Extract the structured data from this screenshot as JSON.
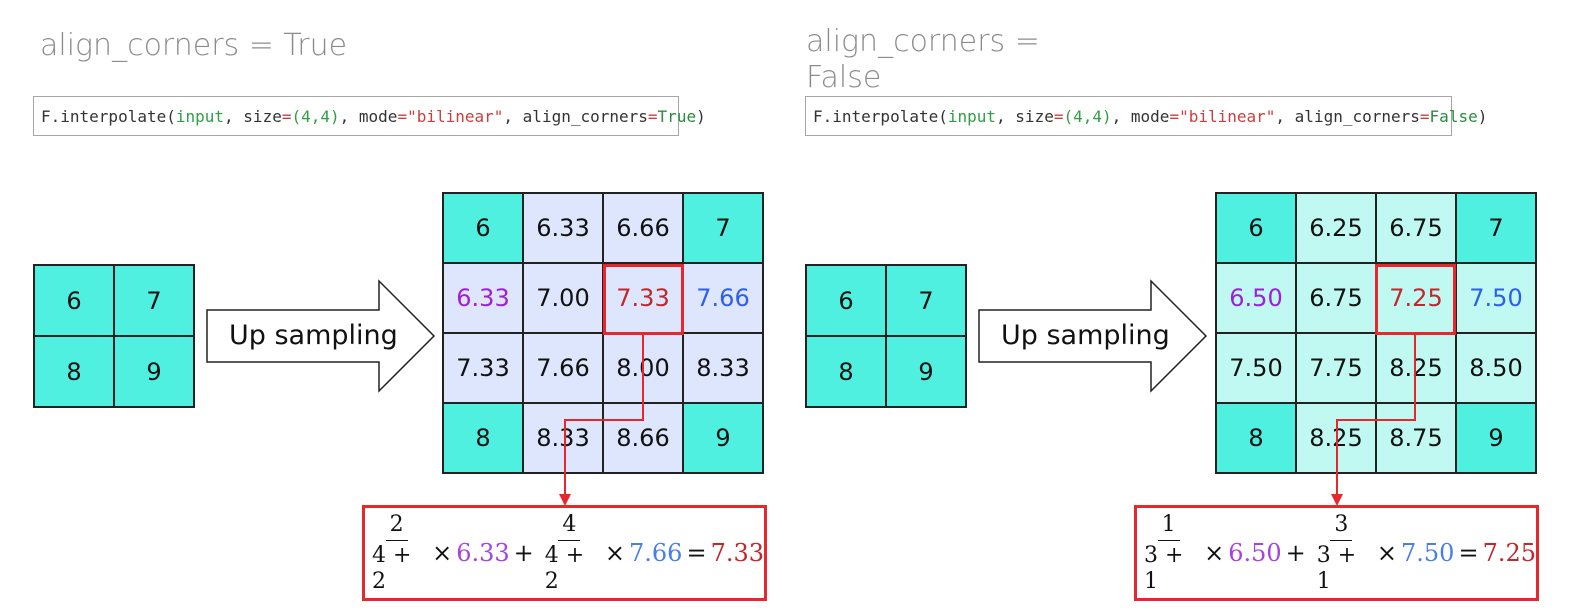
{
  "colors": {
    "corner_cell": "#4ff0e0",
    "left_interp_cell": "#dde6fd",
    "right_interp_cell": "#bff9f1",
    "small_grid_cell": "#4ff0e0",
    "highlight": "#e8262b",
    "purple": "#a020d8",
    "blue": "#2e5fe6",
    "dark_red": "#c1272d",
    "formula_purple": "#a445e0",
    "formula_blue": "#4a7ee8",
    "formula_red": "#c1272d"
  },
  "panels": [
    {
      "title": "align_corners = True",
      "code": {
        "fn": "F.interpolate(",
        "arg_input": "input",
        "sep1": ", size",
        "eq1": "=",
        "size_val": "(4,4)",
        "sep2": ", mode",
        "eq2": "=",
        "mode_val": "\"bilinear\"",
        "sep3": ", align_corners",
        "eq3": "=",
        "bool_val": "True",
        "close": ")"
      },
      "input_grid": [
        "6",
        "7",
        "8",
        "9"
      ],
      "arrow_label": "Up sampling",
      "output_grid": [
        [
          "6",
          "6.33",
          "6.66",
          "7"
        ],
        [
          "6.33",
          "7.00",
          "7.33",
          "7.66"
        ],
        [
          "7.33",
          "7.66",
          "8.00",
          "8.33"
        ],
        [
          "8",
          "8.33",
          "8.66",
          "9"
        ]
      ],
      "formula": {
        "w1_num": "2",
        "w1_den": "4 + 2",
        "times1": "×",
        "v1": "6.33",
        "plus": "+",
        "w2_num": "4",
        "w2_den": "4 + 2",
        "times2": "×",
        "v2": "7.66",
        "eq": "=",
        "result": "7.33"
      }
    },
    {
      "title": "align_corners = False",
      "code": {
        "fn": "F.interpolate(",
        "arg_input": "input",
        "sep1": ", size",
        "eq1": "=",
        "size_val": "(4,4)",
        "sep2": ", mode",
        "eq2": "=",
        "mode_val": "\"bilinear\"",
        "sep3": ", align_corners",
        "eq3": "=",
        "bool_val": "False",
        "close": ")"
      },
      "input_grid": [
        "6",
        "7",
        "8",
        "9"
      ],
      "arrow_label": "Up sampling",
      "output_grid": [
        [
          "6",
          "6.25",
          "6.75",
          "7"
        ],
        [
          "6.50",
          "6.75",
          "7.25",
          "7.50"
        ],
        [
          "7.50",
          "7.75",
          "8.25",
          "8.50"
        ],
        [
          "8",
          "8.25",
          "8.75",
          "9"
        ]
      ],
      "formula": {
        "w1_num": "1",
        "w1_den": "3 + 1",
        "times1": "×",
        "v1": "6.50",
        "plus": "+",
        "w2_num": "3",
        "w2_den": "3 + 1",
        "times2": "×",
        "v2": "7.50",
        "eq": "=",
        "result": "7.25"
      }
    }
  ]
}
